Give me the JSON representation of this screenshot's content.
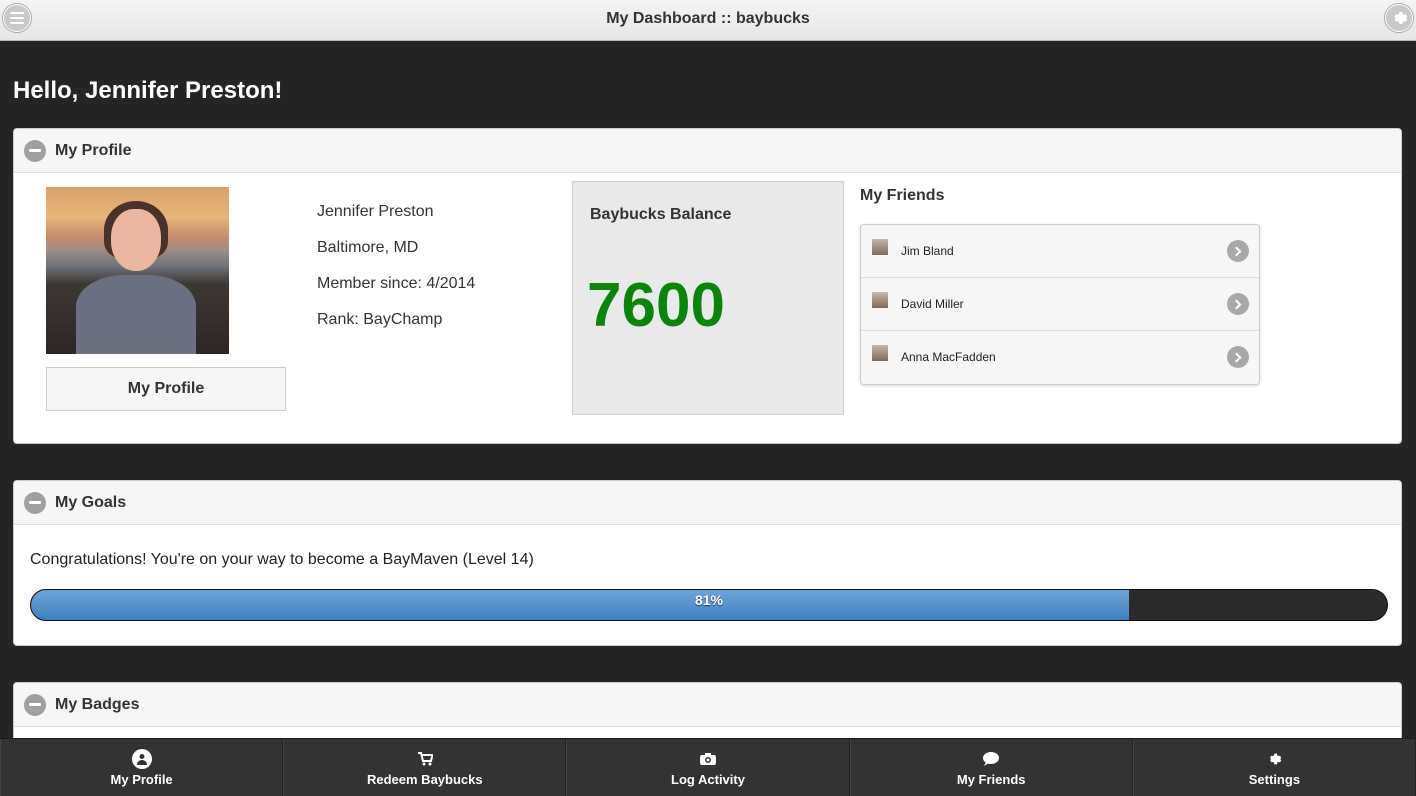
{
  "header": {
    "title": "My Dashboard :: baybucks",
    "menu_icon": "hamburger-icon",
    "settings_icon": "gear-icon"
  },
  "greeting": "Hello, Jennifer Preston!",
  "profile_panel": {
    "heading": "My Profile",
    "name": "Jennifer Preston",
    "location": "Baltimore, MD",
    "member_since": "Member since: 4/2014",
    "rank": "Rank: BayChamp",
    "button_label": "My Profile",
    "balance_title": "Baybucks Balance",
    "balance_value": "7600",
    "balance_color": "#0a840a",
    "friends_title": "My Friends",
    "friends": [
      {
        "name": "Jim Bland"
      },
      {
        "name": "David Miller"
      },
      {
        "name": "Anna MacFadden"
      }
    ]
  },
  "goals_panel": {
    "heading": "My Goals",
    "message": "Congratulations! You're on your way to become a BayMaven (Level 14)",
    "progress_label": "81%",
    "progress_fraction": 0.81,
    "progress_color": "#4a8bcb"
  },
  "badges_panel": {
    "heading": "My Badges"
  },
  "navbar": {
    "items": [
      {
        "label": "My Profile",
        "icon": "user-icon"
      },
      {
        "label": "Redeem Baybucks",
        "icon": "cart-icon"
      },
      {
        "label": "Log Activity",
        "icon": "camera-icon"
      },
      {
        "label": "My Friends",
        "icon": "chat-bubble-icon"
      },
      {
        "label": "Settings",
        "icon": "gear-icon"
      }
    ]
  }
}
